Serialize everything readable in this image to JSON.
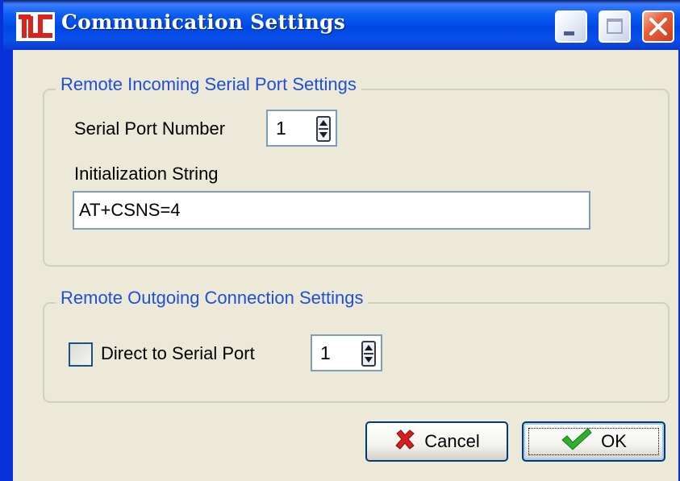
{
  "window": {
    "title": "Communication Settings",
    "logo_text": "TLC",
    "icons": {
      "logo": "tlc-logo-icon",
      "minimize": "minimize-icon",
      "maximize": "maximize-icon",
      "close": "close-icon"
    },
    "colors": {
      "titlebar": "#0a4fe8",
      "close_button": "#e8603b",
      "logo_red": "#d9231c"
    }
  },
  "incoming": {
    "legend": "Remote Incoming Serial Port Settings",
    "serial_port_label": "Serial Port Number",
    "serial_port_value": "1",
    "init_label": "Initialization String",
    "init_value": "AT+CSNS=4"
  },
  "outgoing": {
    "legend": "Remote Outgoing Connection Settings",
    "direct_label": "Direct to Serial Port",
    "direct_checked": false,
    "port_value": "1"
  },
  "buttons": {
    "cancel_label": "Cancel",
    "cancel_icon": "x-cancel-icon",
    "ok_label": "OK",
    "ok_icon": "checkmark-icon"
  },
  "colors": {
    "legend_text": "#1f4fd8",
    "dialog_background": "#ece9d8",
    "cancel_icon": "#d71f1f",
    "ok_icon": "#2fae2f"
  }
}
